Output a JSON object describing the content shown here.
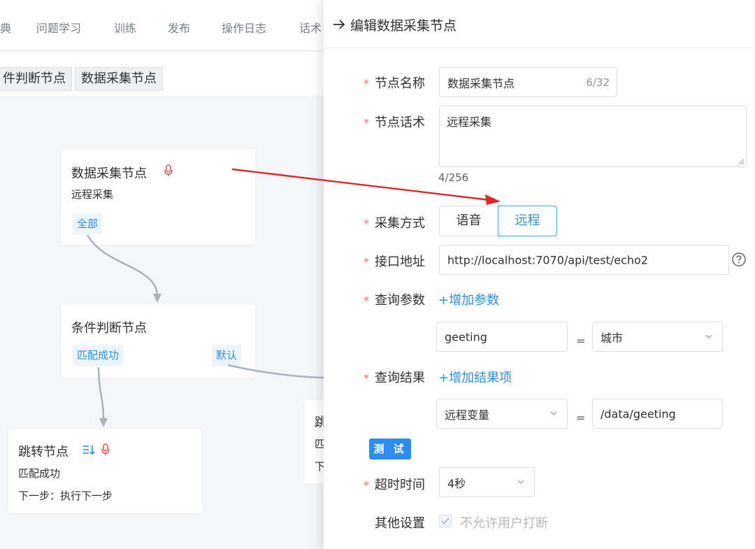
{
  "nav": {
    "tabs": [
      "典",
      "问题学习",
      "训练",
      "发布",
      "操作日志",
      "话术"
    ]
  },
  "breadcrumb": [
    "件判断节点",
    "数据采集节点"
  ],
  "canvas": {
    "nodes": {
      "collect": {
        "title": "数据采集节点",
        "subtitle": "远程采集",
        "tag": "全部"
      },
      "condition": {
        "title": "条件判断节点",
        "tag_match": "匹配成功",
        "tag_default": "默认"
      },
      "jump": {
        "title": "跳转节点",
        "subtitle": "匹配成功",
        "next": "下一步：执行下一步"
      },
      "partial": {
        "title": "跳",
        "line2": "匹",
        "line3": "下"
      }
    }
  },
  "drawer": {
    "title": "编辑数据采集节点",
    "node_name": {
      "label": "节点名称",
      "value": "数据采集节点",
      "count": "6/32"
    },
    "node_script": {
      "label": "节点话术",
      "value": "远程采集",
      "count": "4/256"
    },
    "collect_mode": {
      "label": "采集方式",
      "options": [
        "语音",
        "远程"
      ],
      "selected": "远程"
    },
    "api_url": {
      "label": "接口地址",
      "value": "http://localhost:7070/api/test/echo2"
    },
    "query_params": {
      "label": "查询参数",
      "add_label": "+增加参数",
      "rows": [
        {
          "key": "geeting",
          "eq": "=",
          "value": "城市"
        }
      ]
    },
    "query_results": {
      "label": "查询结果",
      "add_label": "+增加结果项",
      "rows": [
        {
          "key": "远程变量",
          "eq": "=",
          "value": "/data/geeting"
        }
      ]
    },
    "test_button": "测 试",
    "timeout": {
      "label": "超时时间",
      "value": "4秒"
    },
    "other": {
      "label": "其他设置",
      "checkbox_label": "不允许用户打断",
      "checked": true
    }
  },
  "colors": {
    "accent": "#2f8fdc",
    "required": "#f56c6c",
    "arrow": "#e0262b"
  }
}
